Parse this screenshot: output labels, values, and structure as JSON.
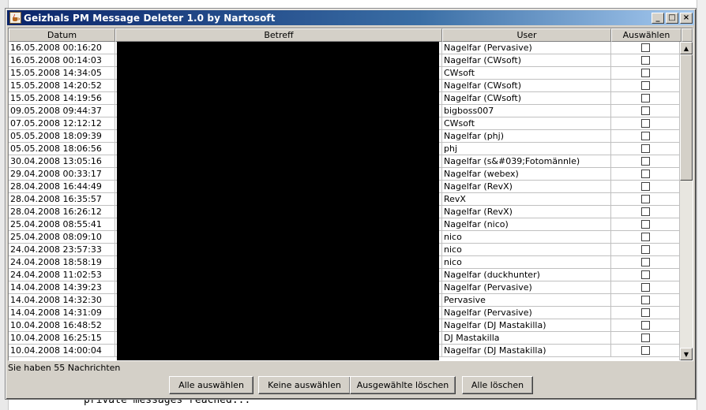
{
  "background": {
    "bottom_text": "private messages reached..."
  },
  "window": {
    "title": "Geizhals PM Message Deleter 1.0 by Nartosoft",
    "controls": {
      "minimize": "_",
      "maximize": "□",
      "close": "×"
    }
  },
  "table": {
    "columns": [
      "Datum",
      "Betreff",
      "User",
      "Auswählen"
    ],
    "rows": [
      {
        "date": "16.05.2008 00:16:20",
        "user": "Nagelfar (Pervasive)"
      },
      {
        "date": "16.05.2008 00:14:03",
        "user": "Nagelfar (CWsoft)"
      },
      {
        "date": "15.05.2008 14:34:05",
        "user": "CWsoft"
      },
      {
        "date": "15.05.2008 14:20:52",
        "user": "Nagelfar (CWsoft)"
      },
      {
        "date": "15.05.2008 14:19:56",
        "user": "Nagelfar (CWsoft)"
      },
      {
        "date": "09.05.2008 09:44:37",
        "user": "bigboss007"
      },
      {
        "date": "07.05.2008 12:12:12",
        "user": "CWsoft"
      },
      {
        "date": "05.05.2008 18:09:39",
        "user": "Nagelfar (phj)"
      },
      {
        "date": "05.05.2008 18:06:56",
        "user": "phj"
      },
      {
        "date": "30.04.2008 13:05:16",
        "user": "Nagelfar (s&#039;Fotomännle)"
      },
      {
        "date": "29.04.2008 00:33:17",
        "user": "Nagelfar (webex)"
      },
      {
        "date": "28.04.2008 16:44:49",
        "user": "Nagelfar (RevX)"
      },
      {
        "date": "28.04.2008 16:35:57",
        "user": "RevX"
      },
      {
        "date": "28.04.2008 16:26:12",
        "user": "Nagelfar (RevX)"
      },
      {
        "date": "25.04.2008 08:55:41",
        "user": "Nagelfar (nico)"
      },
      {
        "date": "25.04.2008 08:09:10",
        "user": "nico"
      },
      {
        "date": "24.04.2008 23:57:33",
        "user": "nico"
      },
      {
        "date": "24.04.2008 18:58:19",
        "user": "nico"
      },
      {
        "date": "24.04.2008 11:02:53",
        "user": "Nagelfar (duckhunter)"
      },
      {
        "date": "14.04.2008 14:39:23",
        "user": "Nagelfar (Pervasive)"
      },
      {
        "date": "14.04.2008 14:32:30",
        "user": "Pervasive"
      },
      {
        "date": "14.04.2008 14:31:09",
        "user": "Nagelfar (Pervasive)"
      },
      {
        "date": "10.04.2008 16:48:52",
        "user": "Nagelfar (DJ Mastakilla)"
      },
      {
        "date": "10.04.2008 16:25:15",
        "user": "DJ Mastakilla"
      },
      {
        "date": "10.04.2008 14:00:04",
        "user": "Nagelfar (DJ Mastakilla)"
      }
    ]
  },
  "scrollbar": {
    "up_icon": "▲",
    "down_icon": "▼"
  },
  "status": {
    "text": "Sie haben 55 Nachrichten"
  },
  "buttons": {
    "select_all": "Alle auswählen",
    "select_none": "Keine auswählen",
    "delete_selected": "Ausgewählte löschen",
    "delete_all": "Alle löschen"
  }
}
